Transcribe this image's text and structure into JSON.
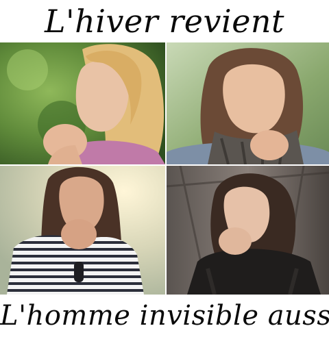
{
  "caption_top": "L'hiver revient",
  "caption_bottom": "L'homme invisible aussi",
  "colors": {
    "background": "#ffffff",
    "text": "#0a0a0a",
    "greenery": "#5f8a3a",
    "skin": "#e9c3a6",
    "blonde_hair": "#e2bd7a",
    "brown_hair": "#6b4a36",
    "dark_hair": "#3a2a22"
  }
}
